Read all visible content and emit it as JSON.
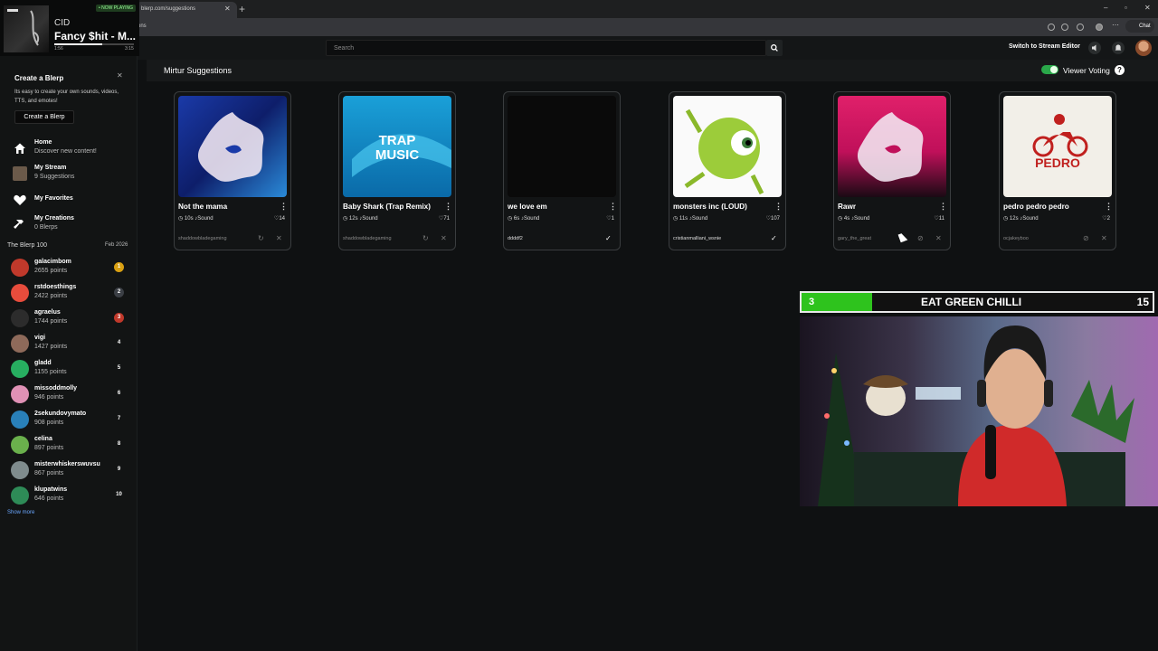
{
  "browser": {
    "tab_title": "blerp.com/suggestions",
    "url_fragment": "ons",
    "chat_label": "Chat"
  },
  "now_playing": {
    "badge": "• NOW PLAYING",
    "artist": "CID",
    "title": "Fancy $hit - M...",
    "elapsed": "1:56",
    "total": "3:15",
    "progress": 0.6
  },
  "header": {
    "search_placeholder": "Search",
    "stream_editor": "Switch to Stream Editor"
  },
  "create_panel": {
    "title": "Create a Blerp",
    "description": "Its easy to create your own sounds, videos, TTS, and emotes!",
    "button": "Create a Blerp"
  },
  "nav": [
    {
      "title": "Home",
      "sub": "Discover new content!",
      "icon": "home-icon"
    },
    {
      "title": "My Stream",
      "sub": "9 Suggestions",
      "icon": "stream-avatar-icon"
    },
    {
      "title": "My Favorites",
      "sub": "",
      "icon": "heart-icon"
    },
    {
      "title": "My Creations",
      "sub": "0 Blerps",
      "icon": "hammer-icon"
    }
  ],
  "leaderboard": {
    "title": "The Blerp 100",
    "month": "Feb 2026",
    "show_more": "Show more",
    "rows": [
      {
        "name": "galacimbom",
        "points": "2655 points",
        "rank": "1",
        "rank_color": "#d9a012",
        "avatar_color": "#c0392b"
      },
      {
        "name": "rstdoesthings",
        "points": "2422 points",
        "rank": "2",
        "rank_color": "#3b3f45",
        "avatar_color": "#e74c3c"
      },
      {
        "name": "agraelus",
        "points": "1744 points",
        "rank": "3",
        "rank_color": "#c0392b",
        "avatar_color": "#2c2c2c"
      },
      {
        "name": "vigi",
        "points": "1427 points",
        "rank": "4",
        "rank_color": "transparent",
        "avatar_color": "#8e6a5a"
      },
      {
        "name": "gladd",
        "points": "1155 points",
        "rank": "5",
        "rank_color": "transparent",
        "avatar_color": "#27ae60"
      },
      {
        "name": "missoddmolly",
        "points": "946 points",
        "rank": "6",
        "rank_color": "transparent",
        "avatar_color": "#e091b5"
      },
      {
        "name": "2sekundovymato",
        "points": "908 points",
        "rank": "7",
        "rank_color": "transparent",
        "avatar_color": "#2980b9"
      },
      {
        "name": "celina",
        "points": "897 points",
        "rank": "8",
        "rank_color": "transparent",
        "avatar_color": "#6ab04c"
      },
      {
        "name": "misterwhiskerswuvsu",
        "points": "867 points",
        "rank": "9",
        "rank_color": "transparent",
        "avatar_color": "#7f8c8d"
      },
      {
        "name": "klupatwins",
        "points": "646 points",
        "rank": "10",
        "rank_color": "transparent",
        "avatar_color": "#2e8b57"
      }
    ]
  },
  "main": {
    "page_title": "Mirtur Suggestions",
    "voting_label": "Viewer Voting",
    "voting_on": true
  },
  "cards": [
    {
      "title": "Not the mama",
      "duration": "10s",
      "type": "Sound",
      "likes": "14",
      "user": "shaddowbladegaming",
      "status": "pending",
      "art": "blerp-blue"
    },
    {
      "title": "Baby Shark (Trap Remix)",
      "duration": "12s",
      "type": "Sound",
      "likes": "71",
      "user": "shaddowbladegaming",
      "status": "pending",
      "art": "trap-music"
    },
    {
      "title": "we love em",
      "duration": "6s",
      "type": "Sound",
      "likes": "1",
      "user": "ddddf2",
      "status": "approved",
      "art": "black"
    },
    {
      "title": "monsters inc (LOUD)",
      "duration": "11s",
      "type": "Sound",
      "likes": "107",
      "user": "cristianmalliani_wsnie",
      "status": "approved",
      "art": "mike"
    },
    {
      "title": "Rawr",
      "duration": "4s",
      "type": "Sound",
      "likes": "11",
      "user": "gary_the_great",
      "status": "blocked",
      "art": "blerp-pink"
    },
    {
      "title": "pedro pedro pedro",
      "duration": "12s",
      "type": "Sound",
      "likes": "2",
      "user": "ocjakeyboo",
      "status": "blocked",
      "art": "pedro"
    }
  ],
  "pedro_art_text": "PEDRO",
  "trap_art_text": "TRAP MUSIC",
  "overlay": {
    "count": "3",
    "label": "EAT GREEN CHILLI",
    "goal": "15",
    "progress": 0.2
  }
}
